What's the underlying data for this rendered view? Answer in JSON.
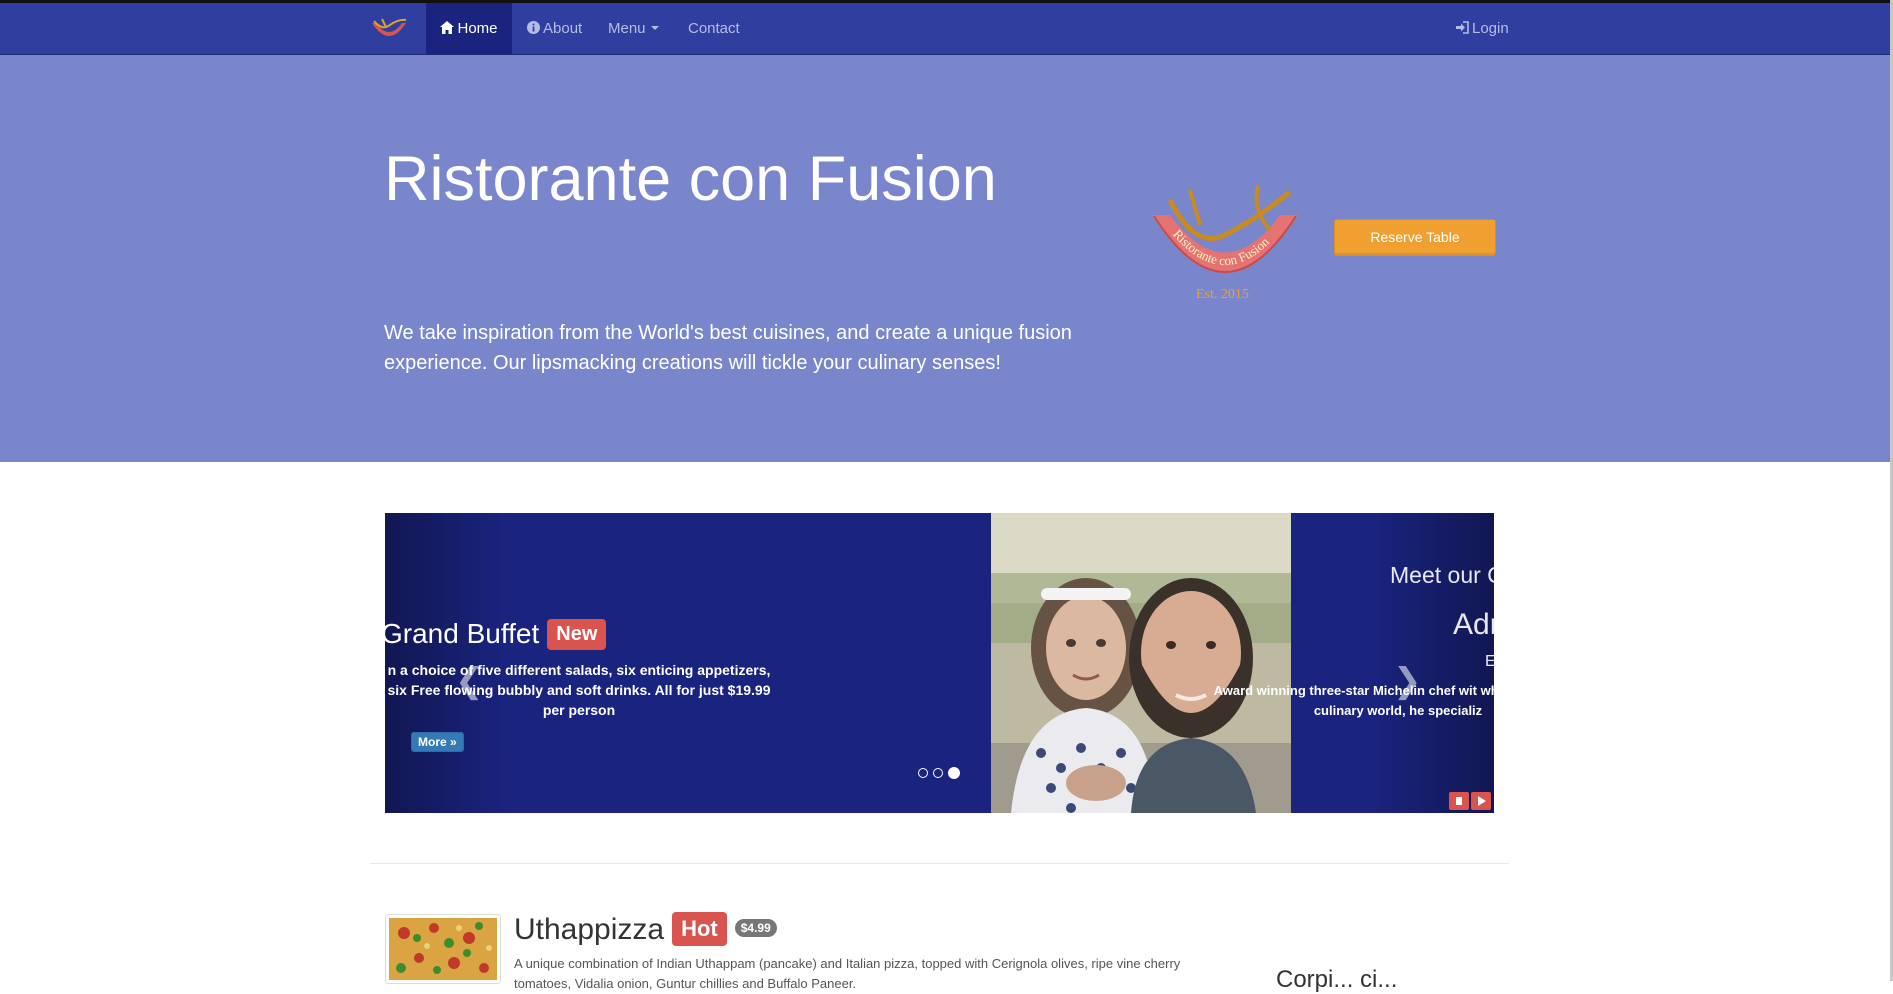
{
  "navbar": {
    "items": [
      {
        "label": "Home",
        "icon": "home-icon",
        "active": true
      },
      {
        "label": "About",
        "icon": "info-icon",
        "active": false
      },
      {
        "label": "Menu",
        "icon": "caret-down-icon",
        "active": false
      },
      {
        "label": "Contact",
        "active": false
      }
    ],
    "login_label": "Login",
    "login_icon": "login-icon"
  },
  "jumbotron": {
    "title": "Ristorante con Fusion",
    "text": "We take inspiration from the World's best cuisines, and create a unique fusion experience. Our lipsmacking creations will tickle your culinary senses!",
    "logo_text": "Ristorante con Fusion",
    "logo_est": "Est. 2015",
    "reserve_label": "Reserve Table"
  },
  "carousel": {
    "slide1": {
      "title": "Grand Buffet",
      "badge": "New",
      "text": "n a choice of five different salads, six enticing appetizers, six Free flowing bubbly and soft drinks. All for just $19.99 per person",
      "more_label": "More »"
    },
    "slide3": {
      "title": "Meet our C",
      "name": "Adr",
      "sub": "E",
      "text": "Award winning three-star Michelin chef wit whos-who in the culinary world, he specializ"
    },
    "indicators": [
      false,
      false,
      true
    ],
    "colors": {
      "background": "#1a237e",
      "control": "#d9534f"
    }
  },
  "featured": {
    "heading": "Uthappizza",
    "badge": "Hot",
    "price": "$4.99",
    "text": "A unique combination of Indian Uthappam (pancake) and Italian pizza, topped with Cerignola olives, ripe vine cherry tomatoes, Vidalia onion, Guntur chillies and Buffalo Paneer."
  },
  "side": {
    "heading": "Corpi... ci..."
  },
  "colors": {
    "navbar": "#303f9f",
    "jumbotron": "#7986cb",
    "reserve": "#f0a030",
    "danger": "#d9534f"
  }
}
